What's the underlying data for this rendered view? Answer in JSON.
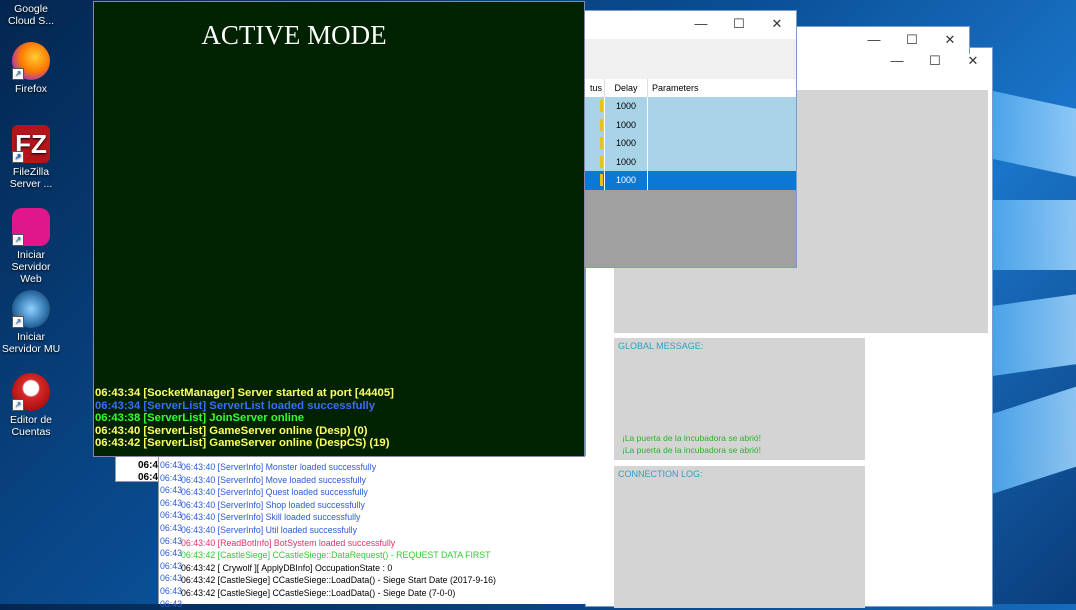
{
  "desktop": {
    "icons": [
      {
        "label": "Google Cloud S...",
        "icon": "google-cloud-icon"
      },
      {
        "label": "Firefox",
        "icon": "firefox-icon"
      },
      {
        "label": "FileZilla Server ...",
        "icon": "filezilla-icon"
      },
      {
        "label": "Iniciar Servidor Web",
        "icon": "web-server-icon"
      },
      {
        "label": "Iniciar Servidor MU",
        "icon": "mu-server-icon"
      },
      {
        "label": "Editor de Cuentas",
        "icon": "account-editor-icon"
      }
    ]
  },
  "window_controls": {
    "minimize": "—",
    "maximize": "☐",
    "close": "✕"
  },
  "table_window": {
    "columns": [
      "tus",
      "Delay",
      "Parameters"
    ],
    "rows": [
      {
        "delay": "1000",
        "params": ""
      },
      {
        "delay": "1000",
        "params": ""
      },
      {
        "delay": "1000",
        "params": ""
      },
      {
        "delay": "1000",
        "params": ""
      },
      {
        "delay": "1000",
        "params": ""
      }
    ]
  },
  "gameserver_window": {
    "global_message_label": "GLOBAL MESSAGE:",
    "global_messages": [
      "¡La puerta de la incubadora se abrió!",
      "¡La puerta de la incubadora se abrió!"
    ],
    "connection_log_label": "CONNECTION LOG:"
  },
  "console": {
    "title": "ACTIVE MODE",
    "lines": [
      {
        "text": "06:43:34 [SocketManager] Server started at port [44405]",
        "color": "#ffff66"
      },
      {
        "text": "06:43:34 [ServerList] ServerList loaded successfully",
        "color": "#3a6cff"
      },
      {
        "text": "06:43:38 [ServerList] JoinServer online",
        "color": "#33ff33"
      },
      {
        "text": "06:43:40 [ServerList] GameServer online (Desp) (0)",
        "color": "#ffff66"
      },
      {
        "text": "06:43:42 [ServerList] GameServer online (DespCS) (19)",
        "color": "#ffff66"
      }
    ]
  },
  "partial_prefix": [
    "06:4",
    "06:4"
  ],
  "gs_log": {
    "prefixes": [
      "06:43",
      "06:43",
      "06:43",
      "06:43",
      "06:43",
      "06:43",
      "06:43",
      "06:43",
      "06:43",
      "06:43",
      "06:43",
      "06:43"
    ],
    "lines": [
      {
        "text": "06:43:40 [ServerInfo] Monster loaded successfully",
        "color": "#2a5bd7"
      },
      {
        "text": "06:43:40 [ServerInfo] Move loaded successfully",
        "color": "#2a5bd7"
      },
      {
        "text": "06:43:40 [ServerInfo] Quest loaded successfully",
        "color": "#2a5bd7"
      },
      {
        "text": "06:43:40 [ServerInfo] Shop loaded successfully",
        "color": "#2a5bd7"
      },
      {
        "text": "06:43:40 [ServerInfo] Skill loaded successfully",
        "color": "#2a5bd7"
      },
      {
        "text": "06:43:40 [ServerInfo] Util loaded successfully",
        "color": "#2a5bd7"
      },
      {
        "text": "06:43:40 [ReadBotInfo] BotSystem loaded successfully",
        "color": "#e0306a"
      },
      {
        "text": "06:43:42 [CastleSiege] CCastleSiege::DataRequest() - REQUEST DATA FIRST",
        "color": "#33c833"
      },
      {
        "text": "06:43:42 [ Crywolf ][ ApplyDBInfo] OccupationState : 0",
        "color": "#000000"
      },
      {
        "text": "06:43:42 [CastleSiege] CCastleSiege::LoadData() - Siege Start Date (2017-9-16)",
        "color": "#000000"
      },
      {
        "text": "06:43:42 [CastleSiege] CCastleSiege::LoadData() - Siege Date (7-0-0)",
        "color": "#000000"
      }
    ]
  },
  "colors": {
    "console_bg": "#002200",
    "selected_row": "#0a78d7",
    "row_bg": "#a9d4e8"
  }
}
